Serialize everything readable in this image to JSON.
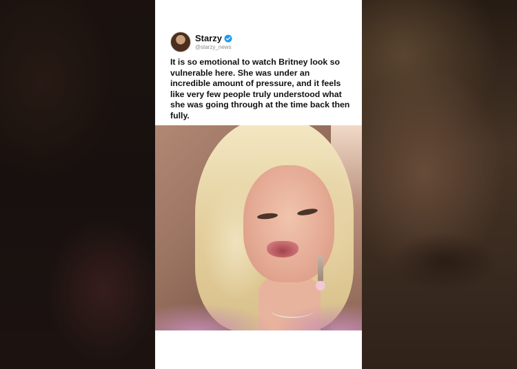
{
  "post": {
    "display_name": "Starzy",
    "handle": "@starzy_news",
    "verified_icon": "verified-badge-icon",
    "verified_color": "#1d9bf0",
    "text": "It is so emotional to watch Britney look so vulnerable here. She was under an incredible amount of pressure, and it feels like very few people truly understood what she was going through at the time back then fully."
  }
}
